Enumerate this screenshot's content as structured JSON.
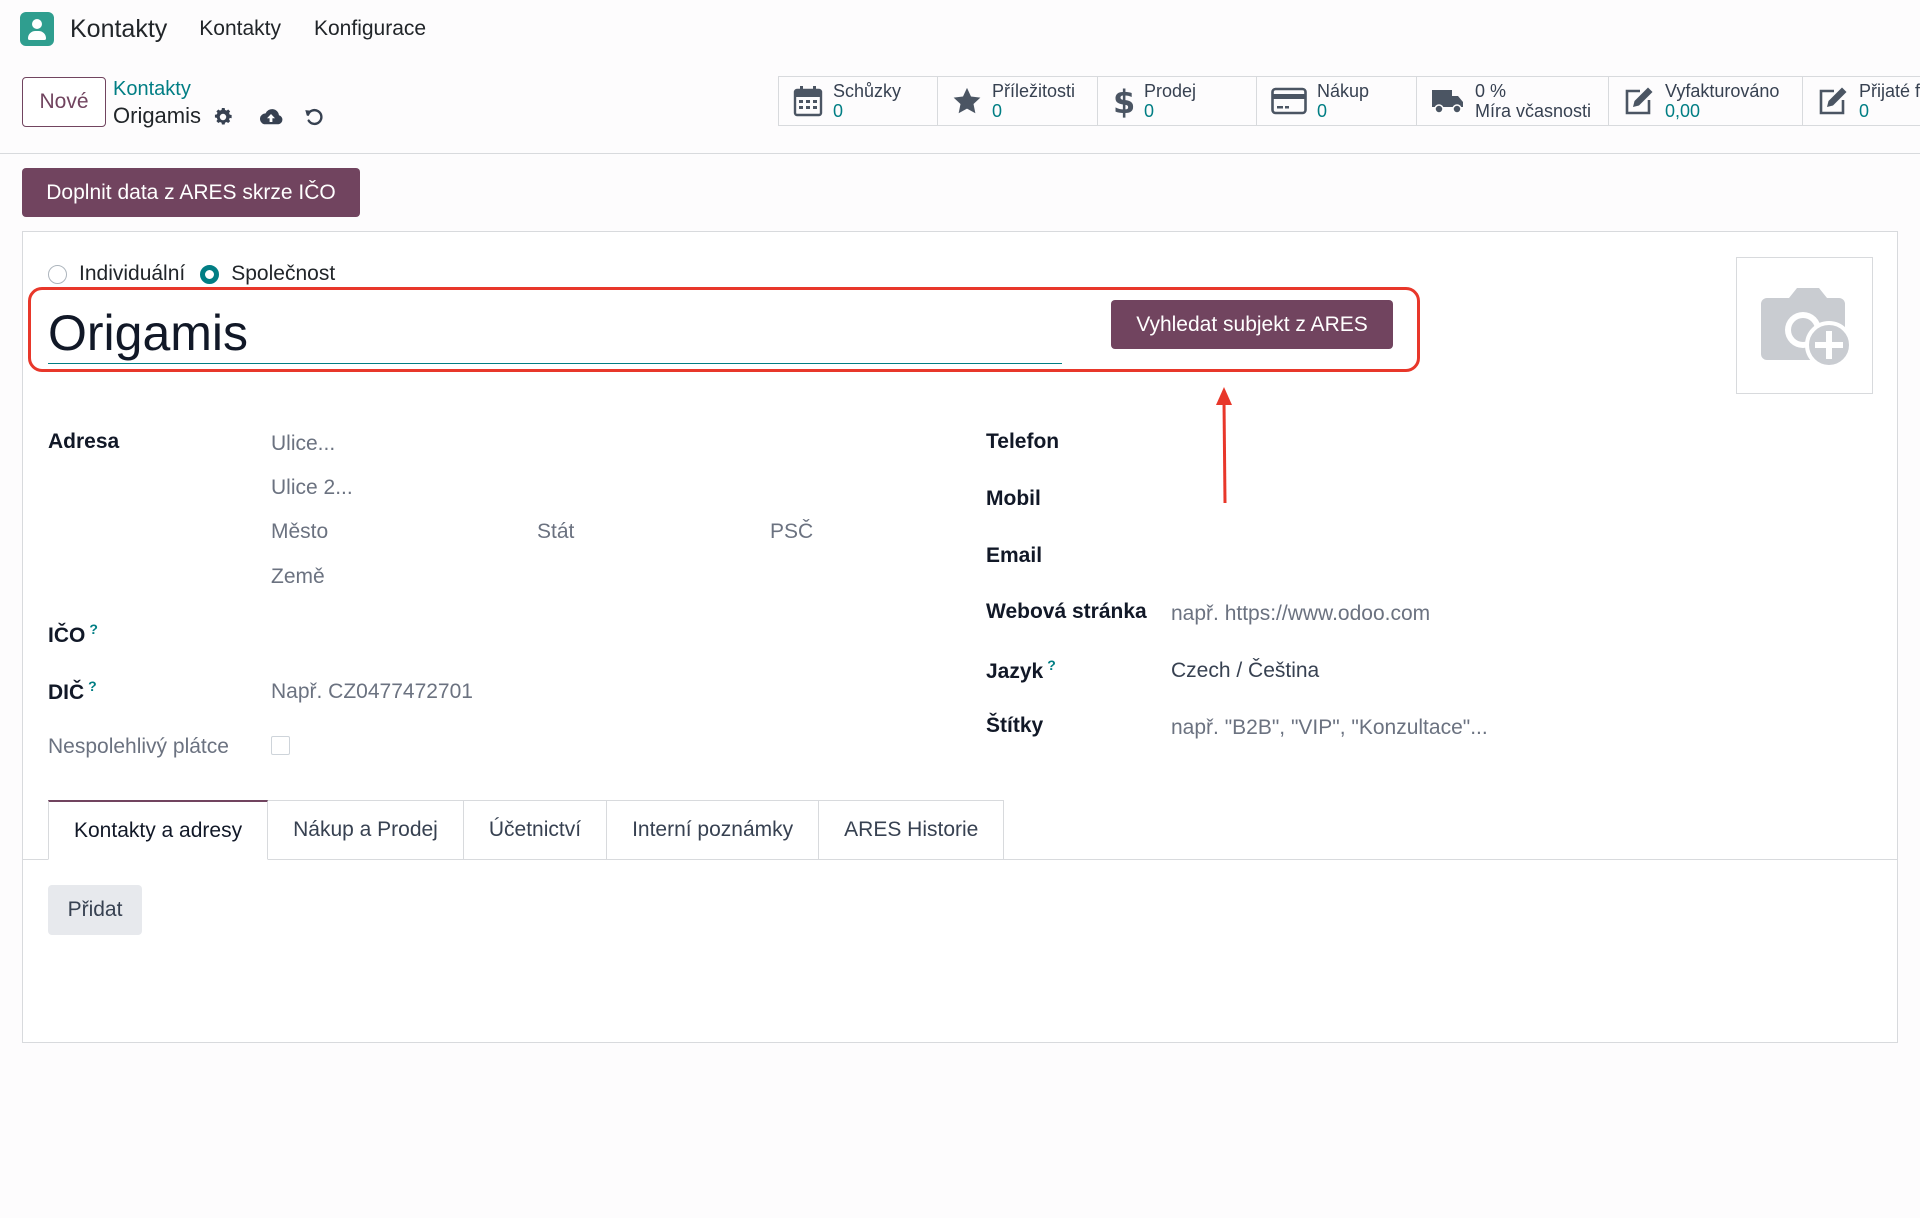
{
  "topnav": {
    "app_name": "Kontakty",
    "menu": [
      "Kontakty",
      "Konfigurace"
    ]
  },
  "control": {
    "new_button": "Nové",
    "breadcrumb_parent": "Kontakty",
    "breadcrumb_current": "Origamis"
  },
  "stats": [
    {
      "label": "Schůzky",
      "value": "0",
      "icon": "calendar-icon"
    },
    {
      "label": "Příležitosti",
      "value": "0",
      "icon": "star-icon"
    },
    {
      "label": "Prodej",
      "value": "0",
      "icon": "dollar-icon"
    },
    {
      "label": "Nákup",
      "value": "0",
      "icon": "credit-card-icon"
    },
    {
      "label": "Míra včasnosti",
      "value": "0 %",
      "icon": "truck-icon"
    },
    {
      "label": "Vyfakturováno",
      "value": "0,00",
      "icon": "edit-icon"
    },
    {
      "label": "Přijaté f",
      "value": "0",
      "icon": "edit-icon"
    }
  ],
  "ares_fill_button": "Doplnit data z ARES skrze IČO",
  "company_type": {
    "options": [
      "Individuální",
      "Společnost"
    ],
    "selected": "Společnost"
  },
  "name": "Origamis",
  "ares_search_button": "Vyhledat subjekt z ARES",
  "colors": {
    "primary": "#71445f",
    "accent": "#017e84",
    "highlight": "#e8372a"
  },
  "address": {
    "label": "Adresa",
    "street_ph": "Ulice...",
    "street2_ph": "Ulice 2...",
    "city_ph": "Město",
    "state_ph": "Stát",
    "zip_ph": "PSČ",
    "country_ph": "Země"
  },
  "ico": {
    "label": "IČO",
    "help": "?"
  },
  "dic": {
    "label": "DIČ",
    "help": "?",
    "placeholder": "Např. CZ0477472701"
  },
  "unreliable": {
    "label": "Nespolehlivý plátce"
  },
  "contact": {
    "phone_label": "Telefon",
    "mobile_label": "Mobil",
    "email_label": "Email",
    "website_label": "Webová stránka",
    "website_ph": "např. https://www.odoo.com",
    "lang_label": "Jazyk",
    "lang_help": "?",
    "lang_value": "Czech / Čeština",
    "tags_label": "Štítky",
    "tags_ph": "např. \"B2B\", \"VIP\", \"Konzultace\"..."
  },
  "tabs": [
    "Kontakty a adresy",
    "Nákup a Prodej",
    "Účetnictví",
    "Interní poznámky",
    "ARES Historie"
  ],
  "add_button": "Přidat"
}
